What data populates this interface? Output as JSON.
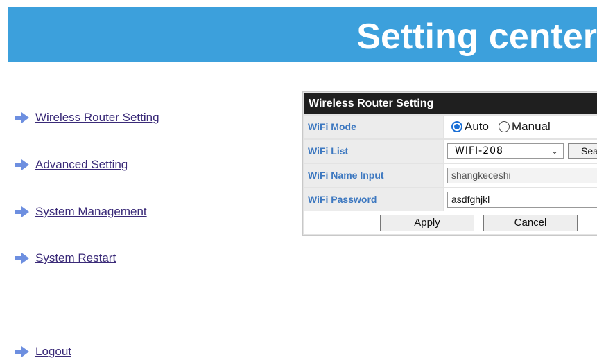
{
  "header": {
    "title": "Setting center"
  },
  "nav": {
    "items": [
      {
        "label": "Wireless Router Setting"
      },
      {
        "label": "Advanced Setting"
      },
      {
        "label": "System Management"
      },
      {
        "label": "System Restart"
      },
      {
        "label": "Logout"
      }
    ],
    "arrow_color": "#6d8fe0",
    "icon": "arrow-right-icon"
  },
  "panel": {
    "title": "Wireless Router Setting",
    "wifi_mode": {
      "label": "WiFi Mode",
      "options": [
        "Auto",
        "Manual"
      ],
      "selected": "Auto"
    },
    "wifi_list": {
      "label": "WiFi List",
      "selected": "WIFI-208",
      "search_label": "Sea"
    },
    "wifi_name": {
      "label": "WiFi Name Input",
      "value": "shangkeceshi"
    },
    "wifi_password": {
      "label": "WiFi Password",
      "value": "asdfghjkl"
    },
    "buttons": {
      "apply": "Apply",
      "cancel": "Cancel"
    }
  },
  "colors": {
    "header_bg": "#3ca0dc",
    "panel_title_bg": "#1f1f1f",
    "label_text": "#3d78c0",
    "link_text": "#3a2a78"
  }
}
